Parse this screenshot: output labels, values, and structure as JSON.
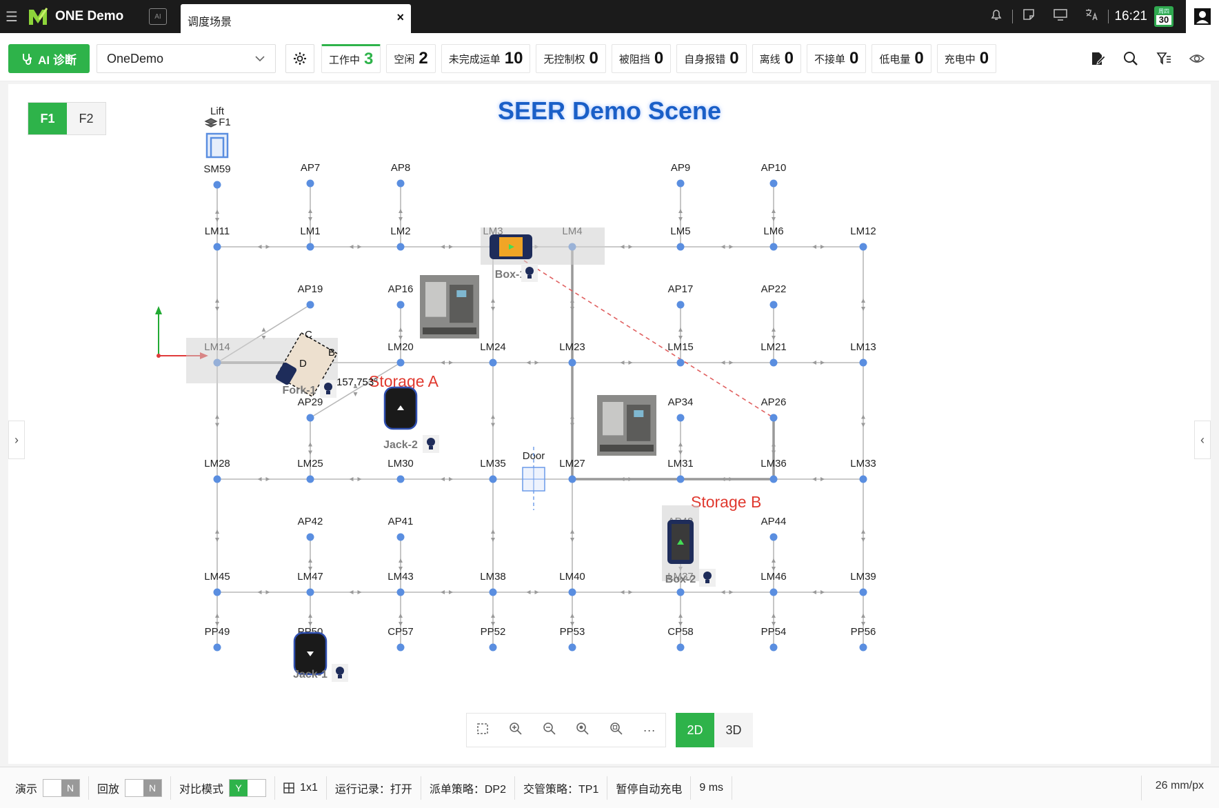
{
  "topbar": {
    "app_name": "ONE Demo",
    "chip_label": "AI",
    "tab_label": "调度场景",
    "tab_close": "×",
    "time": "16:21",
    "calendar_weekday": "周四",
    "calendar_day": "30"
  },
  "toolbar": {
    "ai_button": "AI 诊断",
    "scene_select": "OneDemo",
    "stats": [
      {
        "label": "工作中",
        "count": "3",
        "active": true
      },
      {
        "label": "空闲",
        "count": "2"
      },
      {
        "label": "未完成运单",
        "count": "10"
      },
      {
        "label": "无控制权",
        "count": "0"
      },
      {
        "label": "被阻挡",
        "count": "0"
      },
      {
        "label": "自身报错",
        "count": "0"
      },
      {
        "label": "离线",
        "count": "0"
      },
      {
        "label": "不接单",
        "count": "0"
      },
      {
        "label": "低电量",
        "count": "0"
      },
      {
        "label": "充电中",
        "count": "0"
      }
    ]
  },
  "map": {
    "title": "SEER Demo Scene",
    "floors": [
      "F1",
      "F2"
    ],
    "active_floor": "F1",
    "lift_label": "Lift",
    "lift_floor": "F1",
    "door_label": "Door",
    "storage_a": "Storage A",
    "storage_b": "Storage B",
    "overlay_text": "157.753°",
    "fork_corner_labels": [
      "C",
      "B",
      "D"
    ],
    "robots": [
      {
        "name": "Box-1",
        "kind": "box"
      },
      {
        "name": "Fork-1",
        "kind": "fork"
      },
      {
        "name": "Jack-2",
        "kind": "jack"
      },
      {
        "name": "Box-2",
        "kind": "box"
      },
      {
        "name": "Jack-1",
        "kind": "jack"
      }
    ],
    "points": [
      {
        "name": "SM59"
      },
      {
        "name": "AP7"
      },
      {
        "name": "AP8"
      },
      {
        "name": "AP9"
      },
      {
        "name": "AP10"
      },
      {
        "name": "LM11"
      },
      {
        "name": "LM1"
      },
      {
        "name": "LM2"
      },
      {
        "name": "LM3"
      },
      {
        "name": "LM4"
      },
      {
        "name": "LM5"
      },
      {
        "name": "LM6"
      },
      {
        "name": "LM12"
      },
      {
        "name": "AP19"
      },
      {
        "name": "AP16"
      },
      {
        "name": "AP17"
      },
      {
        "name": "AP22"
      },
      {
        "name": "LM14"
      },
      {
        "name": "LM20"
      },
      {
        "name": "LM24"
      },
      {
        "name": "LM23"
      },
      {
        "name": "LM15"
      },
      {
        "name": "LM21"
      },
      {
        "name": "LM13"
      },
      {
        "name": "AP29"
      },
      {
        "name": "AP34"
      },
      {
        "name": "AP26"
      },
      {
        "name": "LM28"
      },
      {
        "name": "LM25"
      },
      {
        "name": "LM30"
      },
      {
        "name": "LM35"
      },
      {
        "name": "LM27"
      },
      {
        "name": "LM31"
      },
      {
        "name": "LM36"
      },
      {
        "name": "LM33"
      },
      {
        "name": "AP42"
      },
      {
        "name": "AP41"
      },
      {
        "name": "AP48"
      },
      {
        "name": "AP44"
      },
      {
        "name": "LM45"
      },
      {
        "name": "LM47"
      },
      {
        "name": "LM43"
      },
      {
        "name": "LM38"
      },
      {
        "name": "LM40"
      },
      {
        "name": "LM37"
      },
      {
        "name": "LM46"
      },
      {
        "name": "LM39"
      },
      {
        "name": "PP49"
      },
      {
        "name": "PP50"
      },
      {
        "name": "CP57"
      },
      {
        "name": "PP52"
      },
      {
        "name": "PP53"
      },
      {
        "name": "CP58"
      },
      {
        "name": "PP54"
      },
      {
        "name": "PP56"
      }
    ],
    "view_modes": [
      "2D",
      "3D"
    ],
    "active_view": "2D",
    "more_label": "···",
    "accent_color": "#2eb34a",
    "node_color": "#5a8ee0",
    "route_color": "#e06060"
  },
  "statusbar": {
    "demo_label": "演示",
    "demo_value": "N",
    "replay_label": "回放",
    "replay_value": "N",
    "compare_label": "对比模式",
    "compare_value": "Y",
    "grid_value": "1x1",
    "run_log": "运行记录：打开",
    "dispatch_policy": "派单策略：DP2",
    "traffic_policy": "交管策略：TP1",
    "pause_charge": "暂停自动充电",
    "latency": "9 ms",
    "scale": "26 mm/px"
  }
}
